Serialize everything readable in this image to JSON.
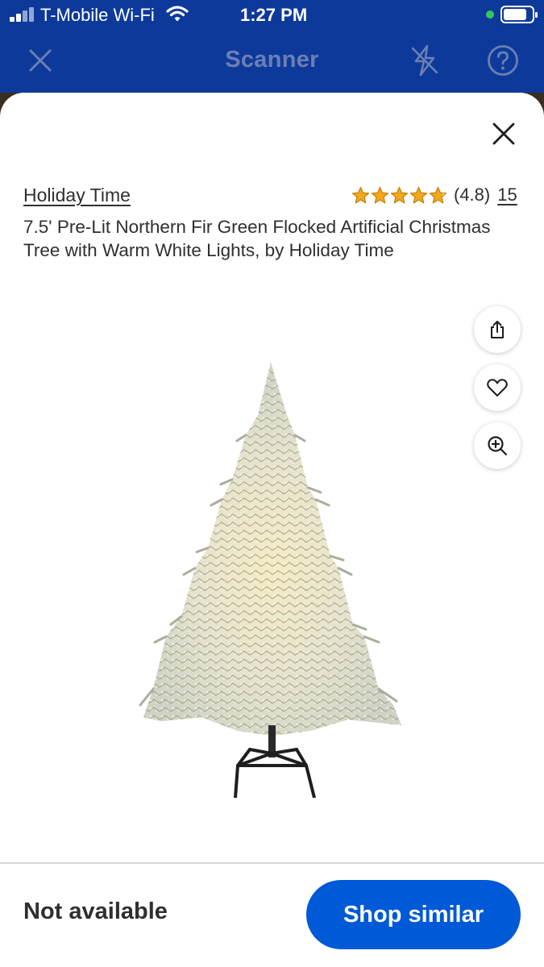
{
  "status_bar": {
    "carrier": "T-Mobile Wi-Fi",
    "time": "1:27 PM"
  },
  "header": {
    "title": "Scanner",
    "icons": [
      "close-icon",
      "flash-off-icon",
      "help-icon"
    ]
  },
  "product": {
    "brand": "Holiday Time",
    "rating_value": "(4.8)",
    "rating": 4.8,
    "rating_count": "15",
    "title": "7.5' Pre-Lit Northern Fir Green Flocked Artificial Christmas Tree with Warm White Lights, by Holiday Time",
    "image": "flocked-christmas-tree-image",
    "actions": [
      "share-icon",
      "heart-icon",
      "zoom-in-icon"
    ]
  },
  "footer": {
    "availability": "Not available",
    "shop_similar_label": "Shop similar"
  },
  "colors": {
    "header_bg": "#0d3a9a",
    "primary_button": "#0059d6",
    "star": "#f2a71c"
  }
}
